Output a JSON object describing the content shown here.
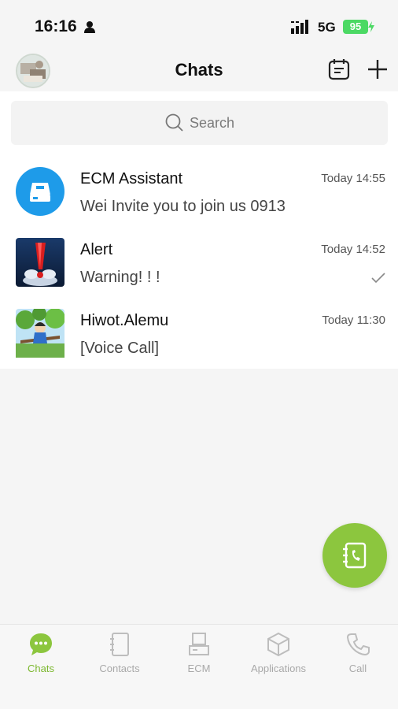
{
  "status_bar": {
    "time": "16:16",
    "network": "5G",
    "battery": "95"
  },
  "header": {
    "title": "Chats"
  },
  "search": {
    "placeholder": "Search"
  },
  "chats": [
    {
      "name": "ECM Assistant",
      "time": "Today 14:55",
      "preview": "Wei Invite you to join us 0913",
      "avatar_icon": "ecm-assistant-icon"
    },
    {
      "name": "Alert",
      "time": "Today 14:52",
      "preview": "Warning! ! !",
      "avatar_icon": "alert-icon",
      "read_status": "check-icon"
    },
    {
      "name": "Hiwot.Alemu",
      "time": "Today 11:30",
      "preview": "[Voice Call]",
      "avatar_icon": "tree-avatar"
    }
  ],
  "nav": {
    "items": [
      {
        "label": "Chats",
        "icon": "chat-bubble-icon",
        "active": true
      },
      {
        "label": "Contacts",
        "icon": "contacts-icon",
        "active": false
      },
      {
        "label": "ECM",
        "icon": "ecm-icon",
        "active": false
      },
      {
        "label": "Applications",
        "icon": "cube-icon",
        "active": false
      },
      {
        "label": "Call",
        "icon": "phone-icon",
        "active": false
      }
    ]
  },
  "colors": {
    "accent": "#8cc63e",
    "active_tab": "#7cb82f",
    "ecm_blue": "#1e9be9"
  }
}
